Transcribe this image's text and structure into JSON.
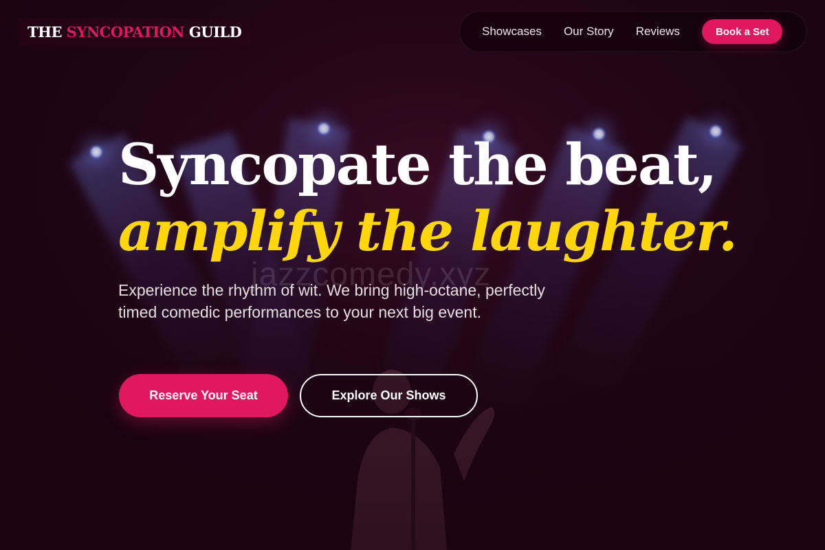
{
  "brand": {
    "logo_part1": "THE ",
    "logo_accent": "SYNCOPATION",
    "logo_part2": " GUILD"
  },
  "nav": {
    "links": [
      "Showcases",
      "Our Story",
      "Reviews"
    ],
    "cta_label": "Book a Set"
  },
  "hero": {
    "headline_line1": "Syncopate the beat,",
    "headline_line2": "amplify the laughter.",
    "subtitle": "Experience the rhythm of wit. We bring high-octane, perfectly timed comedic performances to your next big event.",
    "watermark": "jazzcomedy.xyz",
    "primary_cta": "Reserve Your Seat",
    "secondary_cta": "Explore Our Shows"
  },
  "colors": {
    "accent": "#e0185e",
    "highlight": "#ffd60a",
    "background": "#1a0410"
  }
}
